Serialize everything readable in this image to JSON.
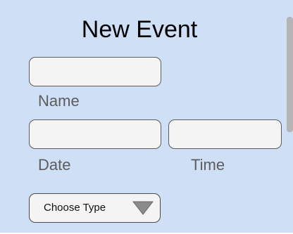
{
  "form": {
    "title": "New Event",
    "fields": {
      "name": {
        "label": "Name",
        "value": ""
      },
      "date": {
        "label": "Date",
        "value": ""
      },
      "time": {
        "label": "Time",
        "value": ""
      }
    },
    "type_select": {
      "selected": "Choose Type",
      "icon": "caret-down-icon"
    }
  },
  "colors": {
    "panel_background": "#cfdff6",
    "field_background": "#f4f4f4",
    "field_border": "#5c5c5c",
    "label_text": "#5c5c5c",
    "scrollbar_thumb": "#b4b4b4",
    "caret": "#8a8a8a"
  }
}
